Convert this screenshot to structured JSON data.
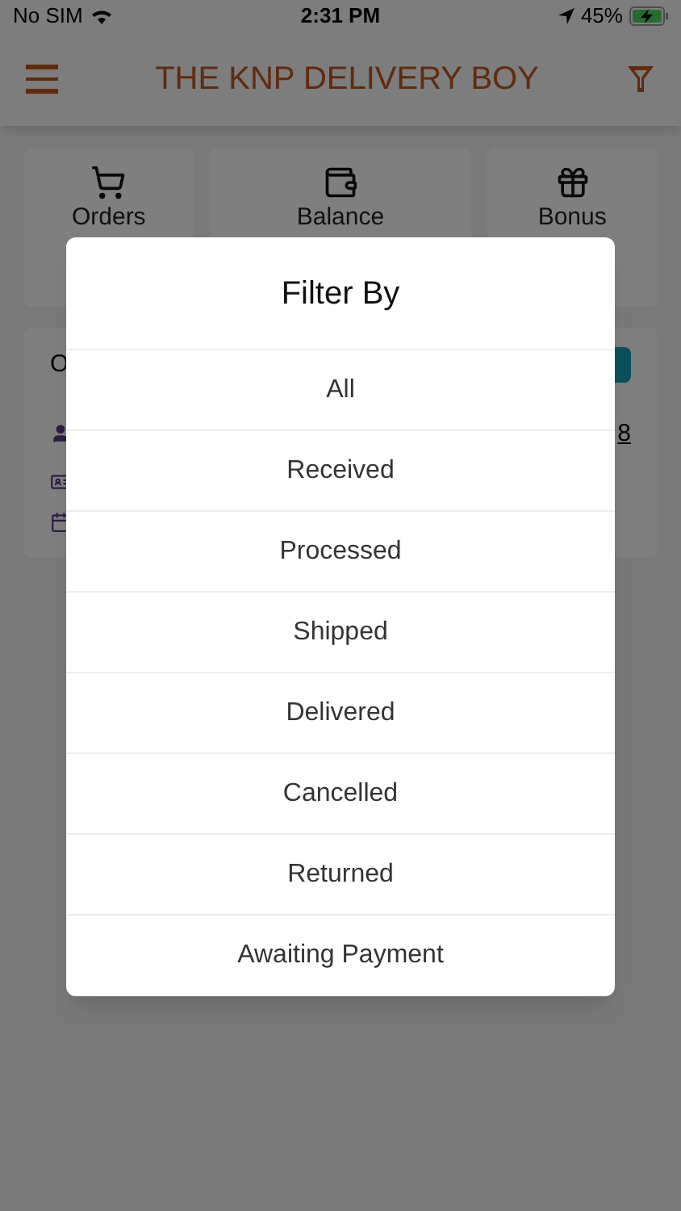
{
  "status_bar": {
    "carrier": "No SIM",
    "time": "2:31 PM",
    "battery": "45%"
  },
  "header": {
    "title": "THE KNP DELIVERY BOY"
  },
  "stats": [
    {
      "kind": "cart",
      "label": "Orders"
    },
    {
      "kind": "wallet",
      "label": "Balance"
    },
    {
      "kind": "gift",
      "label": "Bonus"
    }
  ],
  "order_card": {
    "title": "O",
    "value": "8"
  },
  "dialog": {
    "title": "Filter By",
    "options": [
      "All",
      "Received",
      "Processed",
      "Shipped",
      "Delivered",
      "Cancelled",
      "Returned",
      "Awaiting Payment"
    ]
  }
}
